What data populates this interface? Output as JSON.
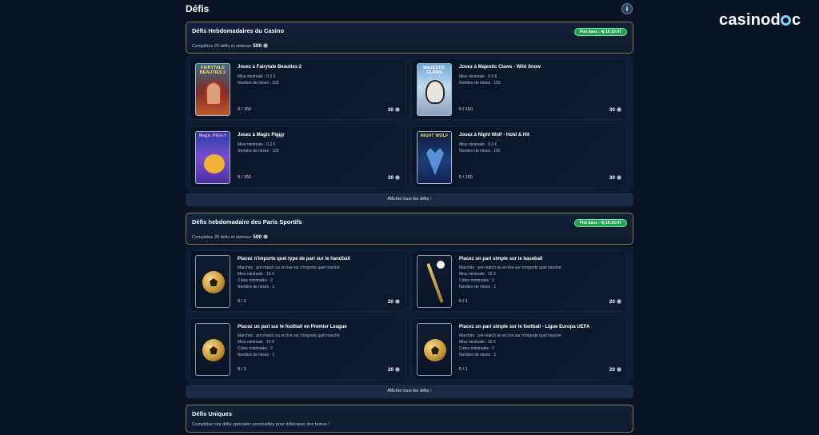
{
  "page": {
    "title": "Défis",
    "info_icon": "info-icon",
    "logo": "casinodoc"
  },
  "casino": {
    "title": "Défis Hebdomadaires du Casino",
    "desc": "Complétez 20 défis et obtenez",
    "reward": "500",
    "timer": "Fini dans : 4j 16:10:47",
    "show_all": "Afficher tous les défis ›",
    "challenges": [
      {
        "title": "Jouez à Fairytale Beauties 2",
        "thumb_label": "FAIRYTALE BEAUTIES 2",
        "line1": "Mise minimale : 0.3 €",
        "line2": "Nombre de mises : 150",
        "progress": "0 / 150",
        "reward": "30"
      },
      {
        "title": "Jouez à Majestic Claws - Wild Snow",
        "thumb_label": "MAJESTIC CLAWS",
        "line1": "Mise minimale : 0.3 €",
        "line2": "Nombre de mises : 150",
        "progress": "0 / 150",
        "reward": "30"
      },
      {
        "title": "Jouez à Magic Piggy",
        "thumb_label": "Magic PIGGY",
        "line1": "Mise minimale : 0.3 €",
        "line2": "Nombre de mises : 150",
        "progress": "0 / 150",
        "reward": "30"
      },
      {
        "title": "Jouez à Night Wolf - Hold & Hit",
        "thumb_label": "NIGHT WOLF",
        "line1": "Mise minimale : 0.3 €",
        "line2": "Nombre de mises : 150",
        "progress": "0 / 150",
        "reward": "30"
      }
    ]
  },
  "sports": {
    "title": "Défis hebdomadaire des Paris Sportifs",
    "desc": "Complétez 20 défis et obtenez",
    "reward": "500",
    "timer": "Fini dans : 4j 16:10:47",
    "show_all": "Afficher tous les défis ›",
    "challenges": [
      {
        "title": "Placez n'importe quel type de pari sur le handball",
        "line1": "Marchés : pré-match ou en live sur n'importe quel marché",
        "line2": "Mise minimale : 15 €",
        "line3": "Cotes minimales : 2",
        "line4": "Nombre de mises : 1",
        "progress": "0 / 1",
        "reward": "20"
      },
      {
        "title": "Placez un pari simple sur le baseball",
        "line1": "Marchés : pré-match ou en live sur n'importe quel marché",
        "line2": "Mise minimale : 15 €",
        "line3": "Cotes minimales : 2",
        "line4": "Nombre de mises : 1",
        "progress": "0 / 1",
        "reward": "20"
      },
      {
        "title": "Placez un pari sur le football en Premier League",
        "line1": "Marchés : pré-match ou en live sur n'importe quel marché",
        "line2": "Mise minimale : 15 €",
        "line3": "Cotes minimales : 2",
        "line4": "Nombre de mises : 1",
        "progress": "0 / 1",
        "reward": "20"
      },
      {
        "title": "Placez un pari simple sur le football - Ligue Europa UEFA",
        "line1": "Marchés : pré-match ou en live sur n'importe quel marché",
        "line2": "Mise minimale : 15 €",
        "line3": "Cotes minimales : 2",
        "line4": "Nombre de mises : 1",
        "progress": "0 / 1",
        "reward": "20"
      }
    ]
  },
  "unique": {
    "title": "Défis Uniques",
    "desc": "Complétez ces défis spéciales ponctuelles pour débloquer des bonus !"
  }
}
